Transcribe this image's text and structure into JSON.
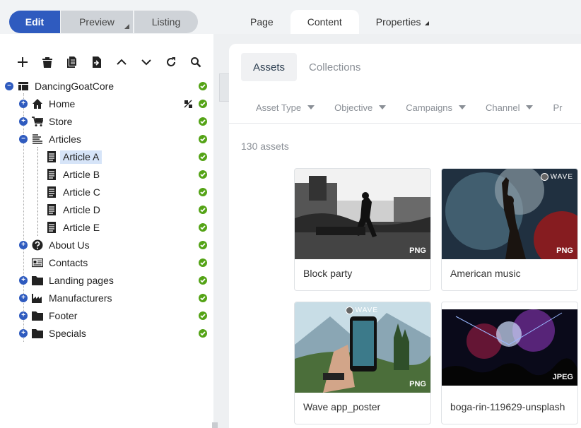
{
  "modes": {
    "edit": "Edit",
    "preview": "Preview",
    "listing": "Listing"
  },
  "tabs": {
    "page": "Page",
    "content": "Content",
    "properties": "Properties"
  },
  "tree": {
    "root": "DancingGoatCore",
    "items": [
      {
        "label": "Home"
      },
      {
        "label": "Store"
      },
      {
        "label": "Articles"
      },
      {
        "label": "Article A"
      },
      {
        "label": "Article B"
      },
      {
        "label": "Article C"
      },
      {
        "label": "Article D"
      },
      {
        "label": "Article E"
      },
      {
        "label": "About Us"
      },
      {
        "label": "Contacts"
      },
      {
        "label": "Landing pages"
      },
      {
        "label": "Manufacturers"
      },
      {
        "label": "Footer"
      },
      {
        "label": "Specials"
      }
    ]
  },
  "content": {
    "subtabs": {
      "assets": "Assets",
      "collections": "Collections"
    },
    "filters": [
      "Asset Type",
      "Objective",
      "Campaigns",
      "Channel",
      "Pr"
    ],
    "asset_count": "130 assets",
    "assets": [
      {
        "title": "Block party",
        "badge": "PNG",
        "logo": ""
      },
      {
        "title": "American music",
        "badge": "PNG",
        "logo": "WAVE"
      },
      {
        "title": "Wave app_poster",
        "badge": "PNG",
        "logo": "WAVE"
      },
      {
        "title": "boga-rin-119629-unsplash",
        "badge": "JPEG",
        "logo": ""
      }
    ]
  },
  "colors": {
    "accent": "#2f5bbf",
    "status_ok": "#54a316",
    "selected": "#d6e4f8"
  }
}
